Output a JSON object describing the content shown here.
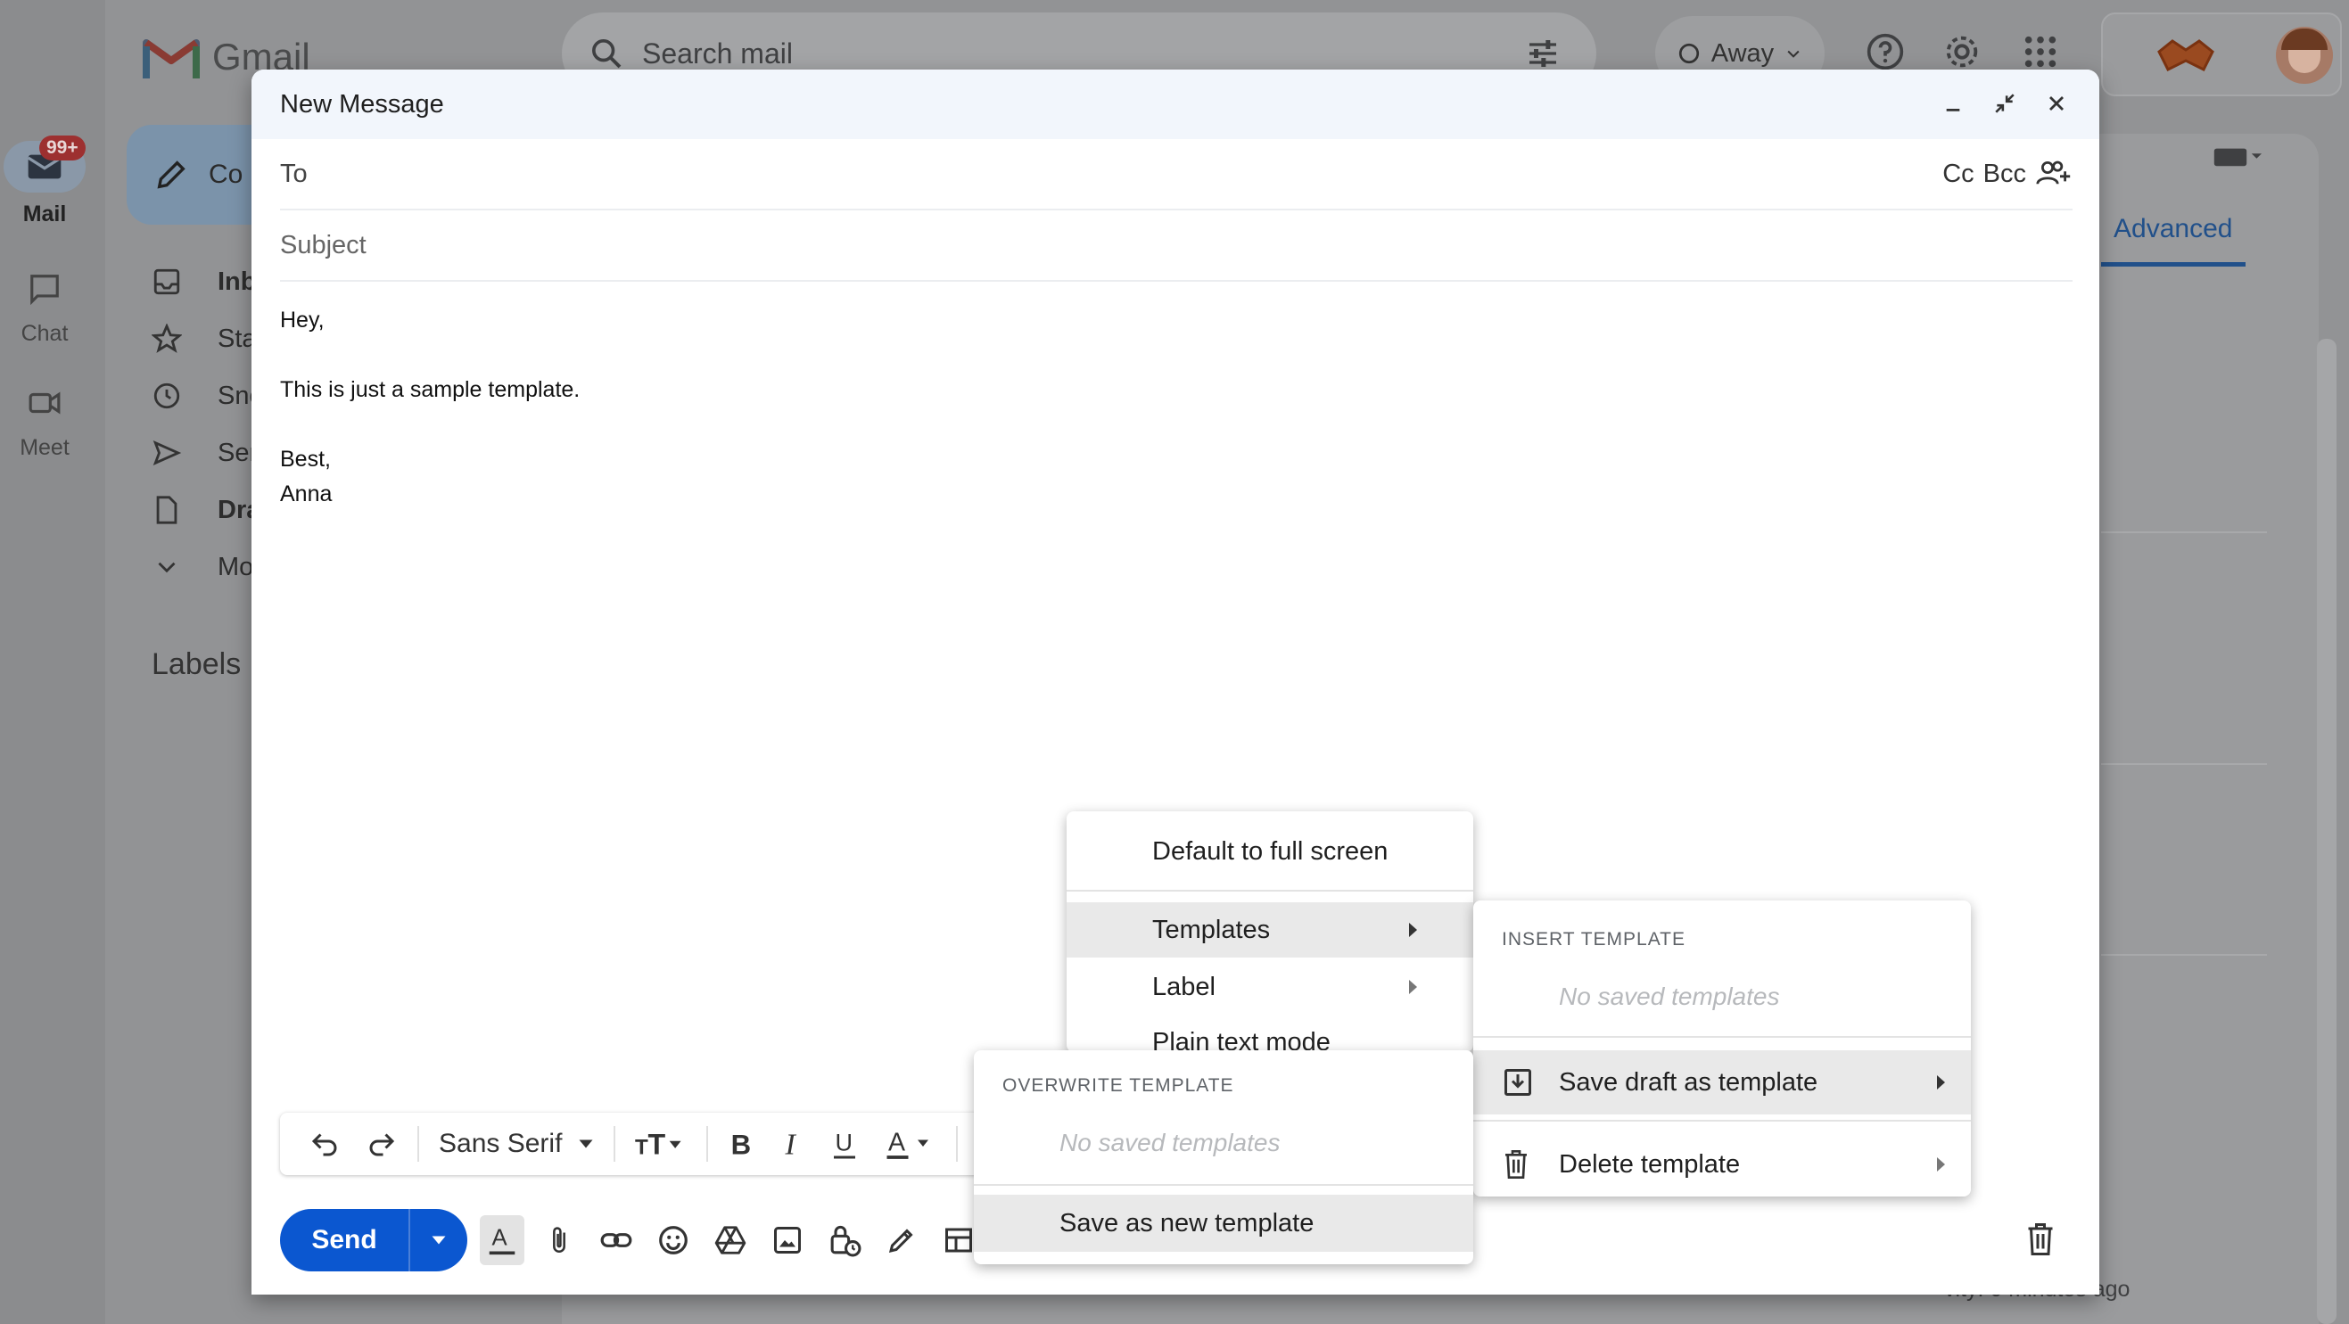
{
  "app": {
    "name": "Gmail"
  },
  "search": {
    "placeholder": "Search mail"
  },
  "status": {
    "label": "Away"
  },
  "rail": [
    {
      "label": "Mail",
      "badge": "99+"
    },
    {
      "label": "Chat"
    },
    {
      "label": "Meet"
    }
  ],
  "sidebar": {
    "compose_label": "Co",
    "items": [
      "Inb",
      "Sta",
      "Sno",
      "Sen",
      "Dra",
      "Mo"
    ],
    "labels_heading": "Labels"
  },
  "right": {
    "advanced_tab": "Advanced"
  },
  "footer": {
    "activity": "vity: 0 minutes ago"
  },
  "compose": {
    "title": "New Message",
    "to_label": "To",
    "cc": "Cc",
    "bcc": "Bcc",
    "subject_placeholder": "Subject",
    "body": "Hey,\n\nThis is just a sample template.\n\nBest,\nAnna",
    "font_family": "Sans Serif",
    "send_label": "Send"
  },
  "more_menu": {
    "items": [
      "Default to full screen",
      "Templates",
      "Label",
      "Plain text mode"
    ],
    "highlighted": "Templates"
  },
  "templates_menu": {
    "insert_header": "INSERT TEMPLATE",
    "insert_empty": "No saved templates",
    "save_draft": "Save draft as template",
    "delete": "Delete template",
    "highlighted": "Save draft as template"
  },
  "save_menu": {
    "overwrite_header": "OVERWRITE TEMPLATE",
    "overwrite_empty": "No saved templates",
    "save_new": "Save as new template"
  },
  "colors": {
    "send": "#0b57d0",
    "header_bg": "#f2f6fc",
    "highlight": "#e9e9e9",
    "advanced": "#21508a"
  }
}
